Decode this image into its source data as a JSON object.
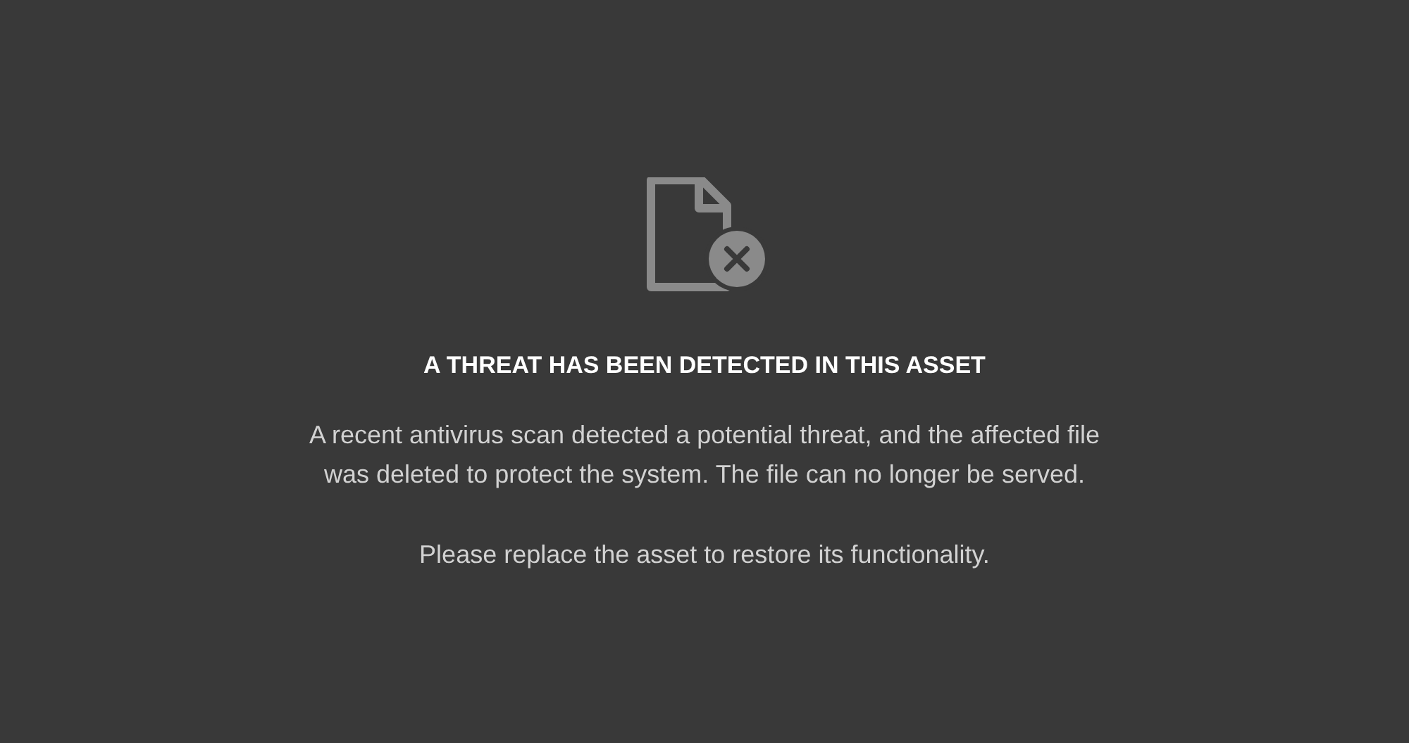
{
  "notice": {
    "title": "A THREAT HAS BEEN DETECTED IN THIS ASSET",
    "message_lines": [
      "A recent antivirus scan detected a potential threat, and the affected file",
      "was deleted to protect the system. The file can no longer be served."
    ],
    "hint": "Please replace the asset to restore its functionality."
  }
}
